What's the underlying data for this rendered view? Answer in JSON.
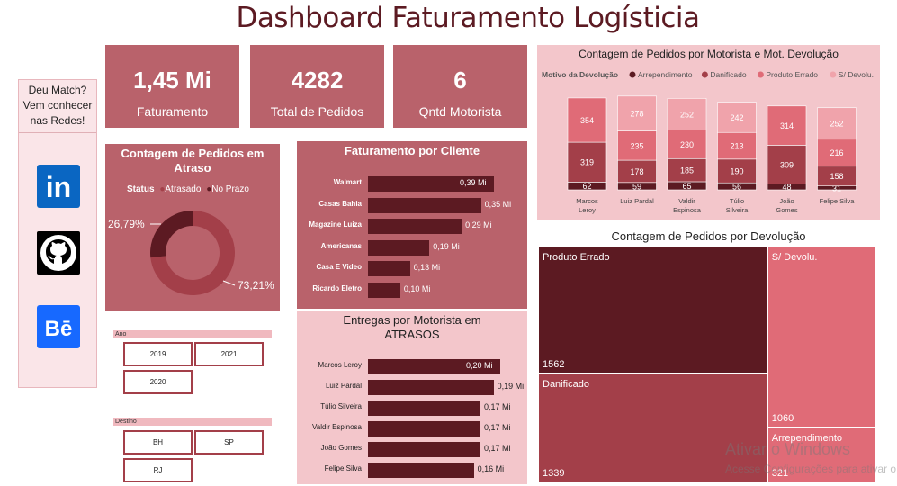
{
  "title": "Dashboard Faturamento Logísticia",
  "social": {
    "text_line1": "Deu Match?",
    "text_line2": "Vem conhecer",
    "text_line3": "nas Redes!",
    "linkedin_glyph": "in",
    "behance_glyph": "Bē",
    "icons": [
      "linkedin-icon",
      "github-icon",
      "behance-icon"
    ]
  },
  "kpis": [
    {
      "value": "1,45 Mi",
      "label": "Faturamento"
    },
    {
      "value": "4282",
      "label": "Total de Pedidos"
    },
    {
      "value": "6",
      "label": "Qntd Motorista"
    }
  ],
  "colors": {
    "dark": "#5c1a22",
    "mid": "#a33f49",
    "light": "#e06b77",
    "lighter": "#f0a3ab",
    "panel": "#b9626b",
    "panel_light": "#f3c6cb"
  },
  "slicers": {
    "ano": {
      "label": "Ano",
      "options": [
        "2019",
        "2021",
        "2020"
      ]
    },
    "destino": {
      "label": "Destino",
      "options": [
        "BH",
        "SP",
        "RJ"
      ]
    }
  },
  "chart_data": [
    {
      "id": "atraso_donut",
      "type": "pie",
      "title": "Contagem de Pedidos em Atraso",
      "legend_title": "Status",
      "legend_position": "top",
      "slices": [
        {
          "name": "Atrasado",
          "value": 73.21,
          "label": "73,21%"
        },
        {
          "name": "No Prazo",
          "value": 26.79,
          "label": "26,79%"
        }
      ]
    },
    {
      "id": "faturamento_cliente",
      "type": "bar",
      "orientation": "horizontal",
      "title": "Faturamento por Cliente",
      "categories": [
        "Walmart",
        "Casas Bahia",
        "Magazine Luiza",
        "Americanas",
        "Casa E Video",
        "Ricardo Eletro"
      ],
      "values": [
        0.39,
        0.35,
        0.29,
        0.19,
        0.13,
        0.1
      ],
      "labels": [
        "0,39 Mi",
        "0,35 Mi",
        "0,29 Mi",
        "0,19 Mi",
        "0,13 Mi",
        "0,10 Mi"
      ],
      "xlim": [
        0,
        0.39
      ]
    },
    {
      "id": "entregas_atraso",
      "type": "bar",
      "orientation": "horizontal",
      "title": "Entregas por Motorista em ATRASOS",
      "categories": [
        "Marcos Leroy",
        "Luiz Pardal",
        "Túlio Silveira",
        "Valdir Espinosa",
        "João Gomes",
        "Felipe Silva"
      ],
      "values": [
        0.2,
        0.19,
        0.17,
        0.17,
        0.17,
        0.16
      ],
      "labels": [
        "0,20 Mi",
        "0,19 Mi",
        "0,17 Mi",
        "0,17 Mi",
        "0,17 Mi",
        "0,16 Mi"
      ],
      "xlim": [
        0,
        0.2
      ]
    },
    {
      "id": "motorista_devolucao",
      "type": "bar",
      "stacked": true,
      "title": "Contagem de Pedidos por Motorista e Mot. Devolução",
      "legend_title": "Motivo da Devolução",
      "legend_position": "top",
      "categories": [
        "Marcos Leroy",
        "Luiz Pardal",
        "Valdir Espinosa",
        "Túlio Silveira",
        "João Gomes",
        "Felipe Silva"
      ],
      "series": [
        {
          "name": "Arrependimento",
          "values": [
            62,
            59,
            65,
            56,
            48,
            31
          ]
        },
        {
          "name": "Danificado",
          "values": [
            319,
            178,
            185,
            190,
            309,
            158
          ]
        },
        {
          "name": "Produto Errado",
          "values": [
            354,
            235,
            230,
            213,
            314,
            216
          ]
        },
        {
          "name": "S/ Devolu.",
          "values": [
            0,
            278,
            252,
            242,
            0,
            252
          ]
        }
      ]
    },
    {
      "id": "devolucao_treemap",
      "type": "treemap",
      "title": "Contagem de Pedidos por Devolução",
      "items": [
        {
          "name": "Produto Errado",
          "value": 1562
        },
        {
          "name": "Danificado",
          "value": 1339
        },
        {
          "name": "S/ Devolu.",
          "value": 1060
        },
        {
          "name": "Arrependimento",
          "value": 321
        }
      ]
    }
  ],
  "watermark": {
    "line1": "Ativar o Windows",
    "line2": "Acesse Configurações para ativar o Windows."
  }
}
